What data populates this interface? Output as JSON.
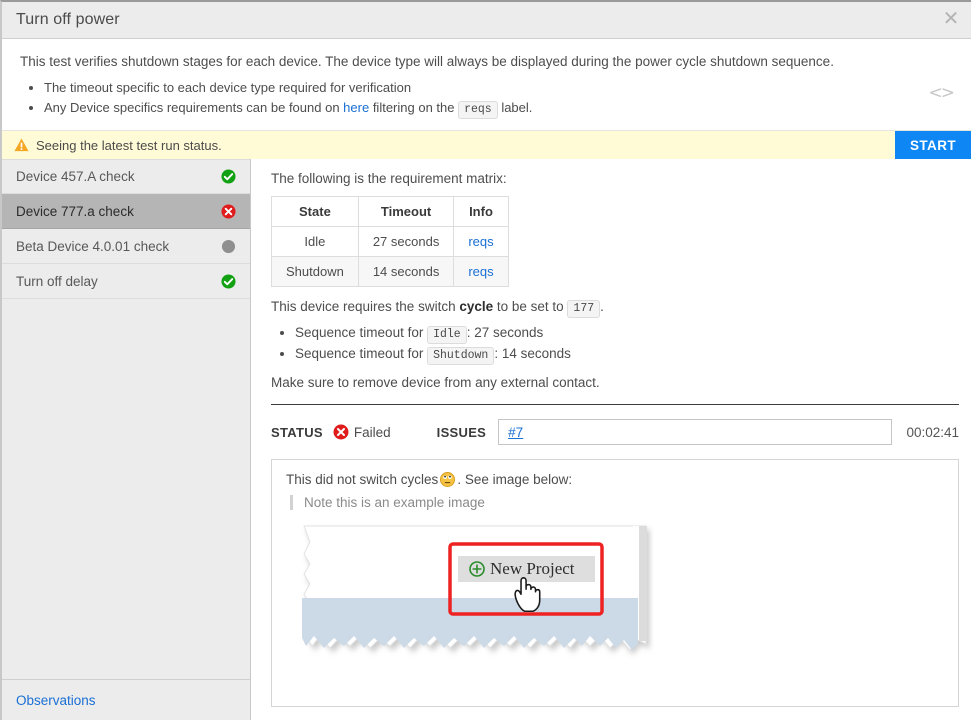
{
  "window": {
    "title": "Turn off power",
    "close_icon": "close-icon"
  },
  "description": {
    "lead": "This test verifies shutdown stages for each device. The device type will always be displayed during the power cycle shutdown sequence.",
    "bullets": [
      {
        "text": "The timeout specific to each device type required for verification"
      },
      {
        "pre": "Any Device specifics requirements can be found on ",
        "link": "here",
        "mid": " filtering on the ",
        "chip": "reqs",
        "post": " label."
      }
    ],
    "code_toggle_icon": "code-brackets-icon"
  },
  "notice": {
    "icon": "warning-triangle-icon",
    "message": "Seeing the latest test run status.",
    "start_label": "START",
    "start_color": "#0e87f5",
    "background": "#fffbd6"
  },
  "sidebar": {
    "items": [
      {
        "label": "Device 457.A check",
        "status": "passed",
        "status_color": "#12a112",
        "selected": false
      },
      {
        "label": "Device 777.a check",
        "status": "failed",
        "status_color": "#e01b1b",
        "selected": true
      },
      {
        "label": "Beta Device 4.0.01 check",
        "status": "pending",
        "status_color": "#8f8f8f",
        "selected": false
      },
      {
        "label": "Turn off delay",
        "status": "passed",
        "status_color": "#12a112",
        "selected": false
      }
    ],
    "observations_label": "Observations"
  },
  "main": {
    "matrix_lead": "The following is the requirement matrix:",
    "matrix": {
      "headers": [
        "State",
        "Timeout",
        "Info"
      ],
      "rows": [
        {
          "state": "Idle",
          "timeout": "27 seconds",
          "info": "reqs"
        },
        {
          "state": "Shutdown",
          "timeout": "14 seconds",
          "info": "reqs"
        }
      ]
    },
    "cycle_line": {
      "pre": "This device requires the switch ",
      "bold": "cycle",
      "mid": " to be set to ",
      "chip": "177",
      "post": "."
    },
    "sequence_bullets": [
      {
        "pre": "Sequence timeout for ",
        "chip": "Idle",
        "post": ": 27 seconds"
      },
      {
        "pre": "Sequence timeout for ",
        "chip": "Shutdown",
        "post": ": 14 seconds"
      }
    ],
    "removal_line": "Make sure to remove device from any external contact.",
    "status": {
      "label": "STATUS",
      "icon": "failed-circle-icon",
      "value": "Failed",
      "value_color": "#e01b1b"
    },
    "issues": {
      "label": "ISSUES",
      "value": "#7"
    },
    "timer": "00:02:41",
    "comment": {
      "pre": "This did not switch cycles ",
      "emoji": "rolling-eyes-emoji",
      "post": ". See image below:",
      "quote": "Note this is an example image",
      "screenshot": {
        "button_label": "New Project",
        "button_icon": "plus-circle-icon",
        "highlight_color": "#ee2222",
        "cursor_icon": "pointing-hand-cursor"
      }
    }
  }
}
